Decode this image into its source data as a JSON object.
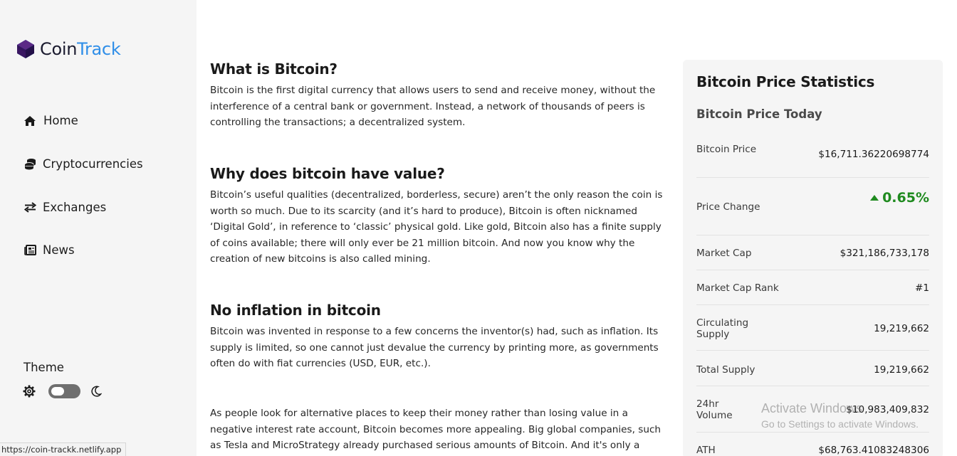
{
  "brand": {
    "name_part1": "Coin",
    "name_part2": "Track",
    "accent": "#2f8ee8",
    "icon": "hexagon-logo-icon"
  },
  "sidebar": {
    "items": [
      {
        "label": "Home",
        "icon": "home-icon"
      },
      {
        "label": "Cryptocurrencies",
        "icon": "coins-icon"
      },
      {
        "label": "Exchanges",
        "icon": "exchange-arrows-icon"
      },
      {
        "label": "News",
        "icon": "newspaper-icon"
      }
    ],
    "theme": {
      "label": "Theme",
      "left_icon": "gear-icon",
      "right_icon": "moon-icon"
    }
  },
  "status_bar": {
    "url": "https://coin-trackk.netlify.app"
  },
  "article": {
    "sections": [
      {
        "heading": "What is Bitcoin?",
        "body": "Bitcoin is the first digital currency that allows users to send and receive money, without the interference of a central bank or government. Instead, a network of thousands of peers is controlling the transactions; a decentralized system."
      },
      {
        "heading": "Why does bitcoin have value?",
        "body": "Bitcoin’s useful qualities (decentralized, borderless, secure) aren’t the only reason the coin is worth so much. Due to its scarcity (and it’s hard to produce), Bitcoin is often nicknamed ‘Digital Gold’, in reference to ‘classic’ physical gold. Like gold, Bitcoin also has a finite supply of coins available; there will only ever be 21 million bitcoin. And now you know why the creation of new bitcoins is also called mining."
      },
      {
        "heading": "No inflation in bitcoin",
        "body": "Bitcoin was invented in response to a few concerns the inventor(s) had, such as inflation. Its supply is limited, so one cannot just devalue the currency by printing more, as governments often do with fiat currencies (USD, EUR, etc.)."
      }
    ],
    "extra_paragraph": "As people look for alternative places to keep their money rather than losing value in a negative interest rate account, Bitcoin becomes more appealing. Big global companies, such as Tesla and MicroStrategy already purchased serious amounts of Bitcoin. And it's only a matter of time"
  },
  "stats": {
    "title": "Bitcoin Price Statistics",
    "subtitle": "Bitcoin Price Today",
    "up_color": "#1f8a1f",
    "rows": [
      {
        "label": "Bitcoin Price",
        "value": "$16,711.36220698774"
      },
      {
        "label": "Price Change",
        "value": "0.65%",
        "icon": "caret-up-icon"
      },
      {
        "label": "Market Cap",
        "value": "$321,186,733,178"
      },
      {
        "label": "Market Cap Rank",
        "value": "#1"
      },
      {
        "label": "Circulating Supply",
        "value": "19,219,662"
      },
      {
        "label": "Total Supply",
        "value": "19,219,662"
      },
      {
        "label": "24hr Volume",
        "value": "$10,983,409,832"
      },
      {
        "label": "ATH",
        "value": "$68,763.41083248306"
      }
    ]
  },
  "watermark": {
    "line1": "Activate Windows",
    "line2": "Go to Settings to activate Windows."
  }
}
